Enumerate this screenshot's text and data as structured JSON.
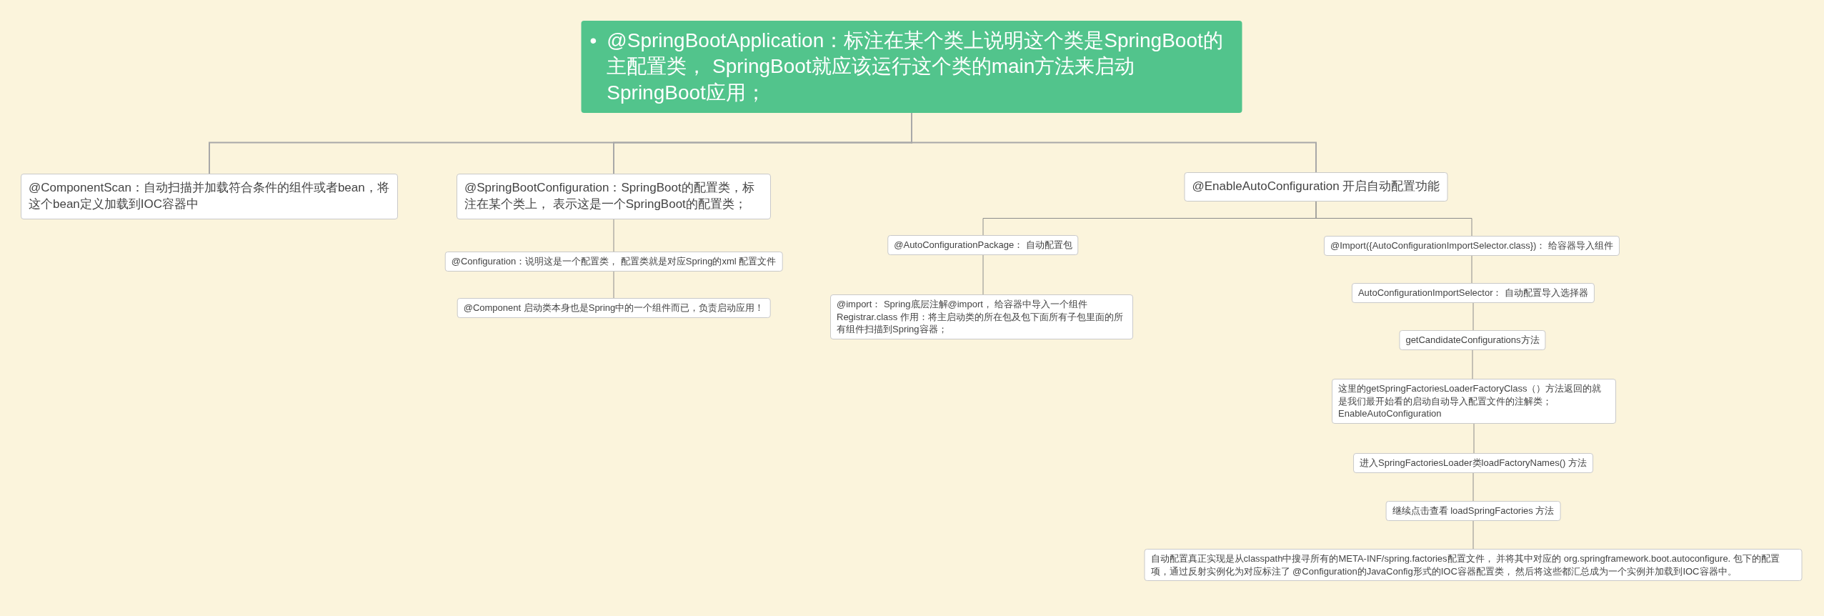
{
  "root": {
    "bullet": "•",
    "text": "@SpringBootApplication：标注在某个类上说明这个类是SpringBoot的主配置类， SpringBoot就应该运行这个类的main方法来启动SpringBoot应用；",
    "children": [
      {
        "text": "@ComponentScan：自动扫描并加载符合条件的组件或者bean，将这个bean定义加载到IOC容器中"
      },
      {
        "text": "@SpringBootConfiguration：SpringBoot的配置类，标注在某个类上， 表示这是一个SpringBoot的配置类；",
        "children": [
          {
            "text": "@Configuration：说明这是一个配置类， 配置类就是对应Spring的xml 配置文件",
            "children": [
              {
                "text": "@Component 启动类本身也是Spring中的一个组件而已，负责启动应用！"
              }
            ]
          }
        ]
      },
      {
        "text": "@EnableAutoConfiguration 开启自动配置功能",
        "children": [
          {
            "text": "@AutoConfigurationPackage： 自动配置包",
            "children": [
              {
                "text": "@import： Spring底层注解@import， 给容器中导入一个组件 Registrar.class 作用：将主启动类的所在包及包下面所有子包里面的所有组件扫描到Spring容器；"
              }
            ]
          },
          {
            "text": "@Import({AutoConfigurationImportSelector.class})： 给容器导入组件",
            "children": [
              {
                "text": "AutoConfigurationImportSelector： 自动配置导入选择器",
                "children": [
                  {
                    "text": "getCandidateConfigurations方法",
                    "children": [
                      {
                        "text": "这里的getSpringFactoriesLoaderFactoryClass（）方法返回的就是我们最开始看的启动自动导入配置文件的注解类；EnableAutoConfiguration",
                        "children": [
                          {
                            "text": "进入SpringFactoriesLoader类loadFactoryNames() 方法",
                            "children": [
                              {
                                "text": "继续点击查看 loadSpringFactories 方法",
                                "children": [
                                  {
                                    "text": "自动配置真正实现是从classpath中搜寻所有的META-INF/spring.factories配置文件， 并将其中对应的 org.springframework.boot.autoconfigure. 包下的配置项，通过反射实例化为对应标注了 @Configuration的JavaConfig形式的IOC容器配置类， 然后将这些都汇总成为一个实例并加载到IOC容器中。"
                                  }
                                ]
                              }
                            ]
                          }
                        ]
                      }
                    ]
                  }
                ]
              }
            ]
          }
        ]
      }
    ]
  }
}
